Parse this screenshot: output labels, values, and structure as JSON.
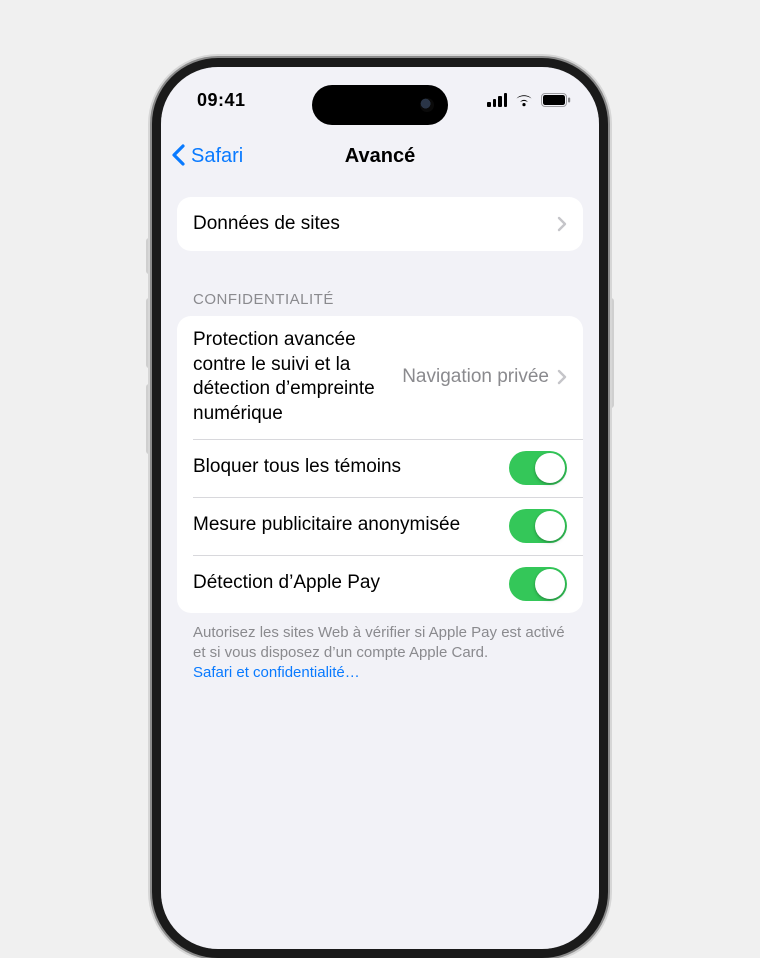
{
  "status": {
    "time": "09:41"
  },
  "nav": {
    "back": "Safari",
    "title": "Avancé"
  },
  "group1": {
    "website_data": "Données de sites"
  },
  "privacy": {
    "header": "CONFIDENTIALITÉ",
    "tracking_label": "Protection avancée contre le suivi et la détection d’empreinte numérique",
    "tracking_value": "Navigation privée",
    "block_cookies": "Bloquer tous les témoins",
    "ad_measurement": "Mesure publicitaire anonymisée",
    "apple_pay": "Détection d’Apple Pay"
  },
  "footer": {
    "text": "Autorisez les sites Web à vérifier si Apple Pay est activé et si vous disposez d’un compte Apple Card.",
    "link": "Safari et confidentialité…"
  },
  "toggles": {
    "block_cookies": true,
    "ad_measurement": true,
    "apple_pay": true
  }
}
